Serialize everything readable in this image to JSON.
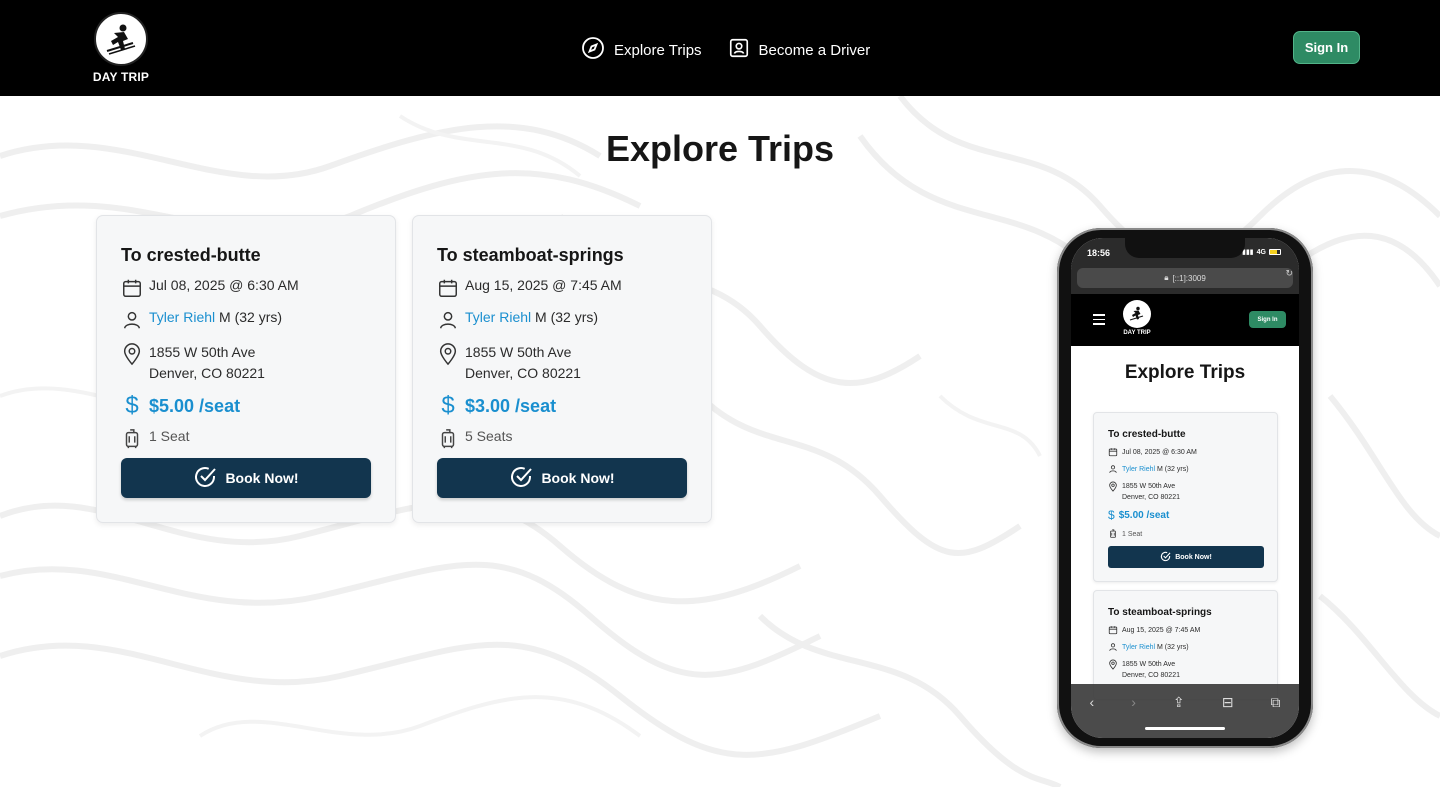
{
  "header": {
    "logo_text": "DAY TRIP",
    "nav": [
      {
        "label": "Explore Trips",
        "icon": "compass-icon"
      },
      {
        "label": "Become a Driver",
        "icon": "id-badge-icon"
      }
    ],
    "signin_label": "Sign In"
  },
  "main": {
    "title": "Explore Trips",
    "trips": [
      {
        "title": "To crested-butte",
        "date": "Jul 08, 2025 @ 6:30 AM",
        "driver_name": "Tyler Riehl",
        "driver_meta": "M (32 yrs)",
        "address_line1": "1855 W 50th Ave",
        "address_line2": "Denver, CO 80221",
        "price": "$5.00 /seat",
        "seats": "1 Seat",
        "book_label": "Book Now!"
      },
      {
        "title": "To steamboat-springs",
        "date": "Aug 15, 2025 @ 7:45 AM",
        "driver_name": "Tyler Riehl",
        "driver_meta": "M (32 yrs)",
        "address_line1": "1855 W 50th Ave",
        "address_line2": "Denver, CO 80221",
        "price": "$3.00 /seat",
        "seats": "5 Seats",
        "book_label": "Book Now!"
      }
    ]
  },
  "phone": {
    "time": "18:56",
    "network": "4G",
    "url": "[::1]:3009",
    "signin_label": "Sign In",
    "logo_text": "DAY TRIP",
    "title": "Explore Trips",
    "price_short": "$5.00 /seat"
  },
  "colors": {
    "header_bg": "#000000",
    "signin_bg": "#2e8b64",
    "button_bg": "#12354e",
    "accent_blue": "#1a8fcf"
  }
}
